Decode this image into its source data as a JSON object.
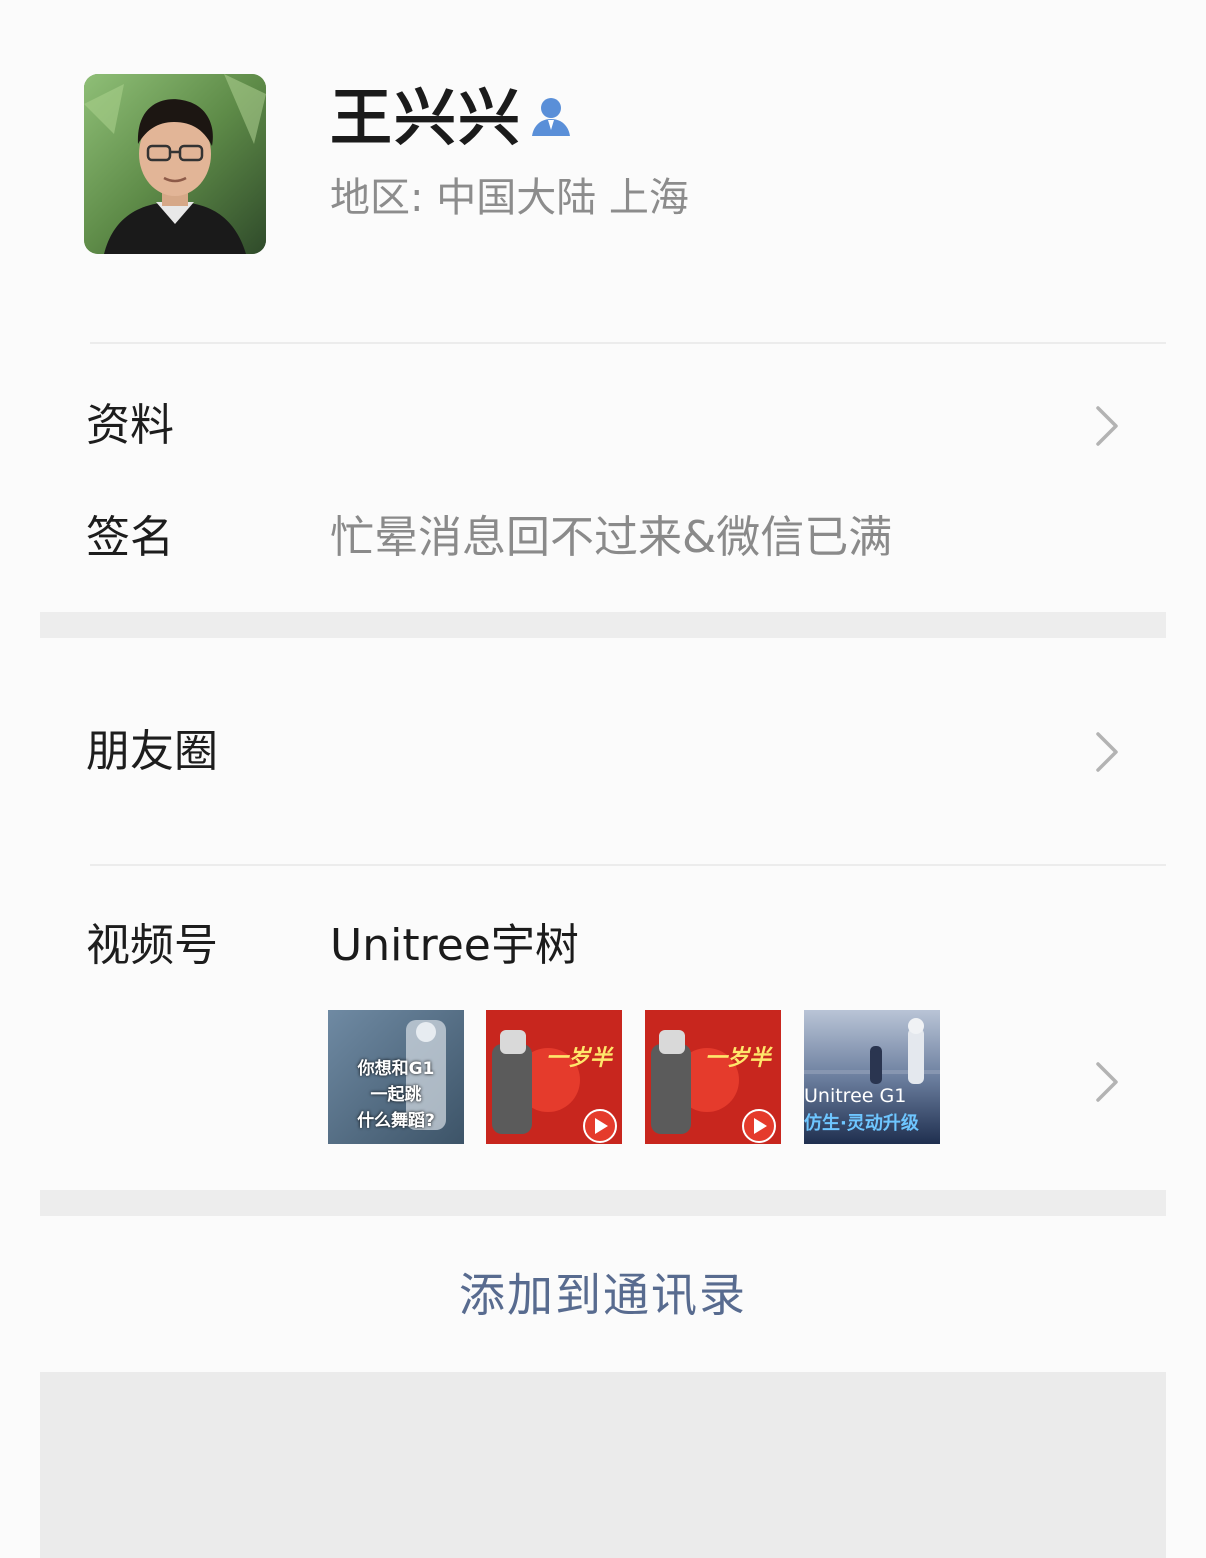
{
  "profile": {
    "name": "王兴兴",
    "region": "地区:  中国大陆  上海",
    "avatar_icon": "user-avatar-photo",
    "verified_icon": "person-icon"
  },
  "rows": {
    "info_label": "资料",
    "signature_label": "签名",
    "signature_value": "忙晕消息回不过来&微信已满",
    "moments_label": "朋友圈",
    "channels_label": "视频号",
    "channels_name": "Unitree宇树"
  },
  "thumbnails": [
    {
      "line1": "你想和G1",
      "line2": "一起跳",
      "line3": "什么舞蹈?"
    },
    {
      "line1": "一岁半"
    },
    {
      "line1": "一岁半"
    },
    {
      "line1": "Unitree G1",
      "line2": "仿生·灵动升级"
    }
  ],
  "actions": {
    "add_contact": "添加到通讯录"
  },
  "colors": {
    "link_blue": "#586b8f",
    "icon_blue": "#5a8fd8",
    "text_gray": "#8a8a8a"
  }
}
